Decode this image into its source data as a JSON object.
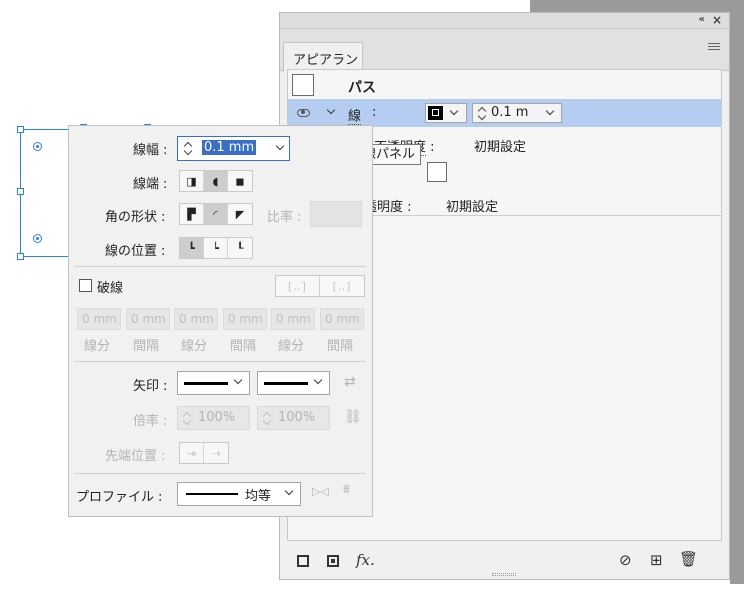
{
  "appearance_panel": {
    "tab_title": "アピアランス",
    "collapse_icon": "«",
    "close_icon": "×",
    "path_label": "パス",
    "stroke_row": {
      "label": "線",
      "colon": ":",
      "weight_value": "0.1 m"
    },
    "opacity_row_1": {
      "label": "不透明度",
      "colon": ":",
      "value": "初期設定"
    },
    "fill_row": {
      "colon": ":"
    },
    "opacity_row_2": {
      "label": "透明度",
      "colon": ":",
      "value": "初期設定"
    },
    "footer_fx": "fx."
  },
  "tooltip": {
    "text": "線パネル"
  },
  "stroke_panel": {
    "weight": {
      "label": "線幅",
      "colon": ":",
      "value": "0.1 mm"
    },
    "cap": {
      "label": "線端",
      "colon": ":"
    },
    "corner": {
      "label": "角の形状",
      "colon": ":",
      "limit_label": "比率",
      "limit_colon": ":"
    },
    "align": {
      "label": "線の位置",
      "colon": ":"
    },
    "dashed": {
      "label": "破線",
      "cells": [
        "0 mm",
        "0 mm",
        "0 mm",
        "0 mm",
        "0 mm",
        "0 mm"
      ],
      "cell_labels": [
        "線分",
        "間隔",
        "線分",
        "間隔",
        "線分",
        "間隔"
      ]
    },
    "arrowheads": {
      "label": "矢印",
      "colon": ":"
    },
    "scale": {
      "label": "倍率",
      "colon": ":",
      "start_value": "100%",
      "end_value": "100%"
    },
    "align_tip": {
      "label": "先端位置",
      "colon": ":"
    },
    "profile": {
      "label": "プロファイル",
      "colon": ":",
      "value": "均等"
    }
  },
  "colors": {
    "selection_blue": "#2d7ff9",
    "row_highlight": "#b4cdf0",
    "value_highlight": "#3a6fc9"
  }
}
